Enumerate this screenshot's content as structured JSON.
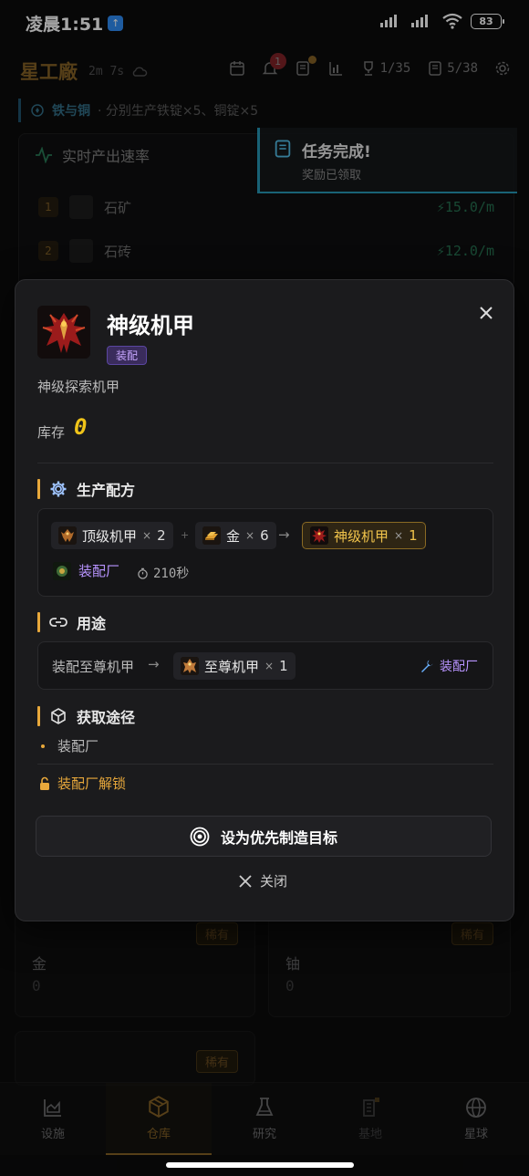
{
  "statusbar": {
    "time": "凌晨1:51",
    "battery": "83"
  },
  "header": {
    "brand": "星工廠",
    "timer": "2m 7s",
    "notif_count": "1",
    "achievements": "1/35",
    "tasks": "5/38"
  },
  "ticker": {
    "name": "铁与铜",
    "desc": "· 分别生产铁锭×5、铜锭×5"
  },
  "rate_panel": {
    "title": "实时产出速率",
    "rows": [
      {
        "rank": "1",
        "name": "石矿",
        "rate": "15.0/m"
      },
      {
        "rank": "2",
        "name": "石砖",
        "rate": "12.0/m"
      }
    ]
  },
  "toast": {
    "title": "任务完成!",
    "subtitle": "奖励已领取"
  },
  "bg_cards": [
    {
      "name": "金",
      "count": "0",
      "rarity": "稀有"
    },
    {
      "name": "铀",
      "count": "0",
      "rarity": "稀有"
    },
    {
      "rarity": "稀有"
    }
  ],
  "modal": {
    "title": "神级机甲",
    "category": "装配",
    "description": "神级探索机甲",
    "stock_label": "库存",
    "stock_value": "0",
    "recipe_heading": "生产配方",
    "recipe": {
      "inputs": [
        {
          "name": "顶级机甲",
          "mult": "×",
          "qty": "2"
        },
        {
          "name": "金",
          "mult": "×",
          "qty": "6"
        }
      ],
      "output": {
        "name": "神级机甲",
        "mult": "×",
        "qty": "1"
      },
      "factory": "装配厂",
      "duration": "210秒"
    },
    "usage_heading": "用途",
    "usage": {
      "text": "装配至尊机甲",
      "target": {
        "name": "至尊机甲",
        "mult": "×",
        "qty": "1"
      },
      "factory": "装配厂"
    },
    "source_heading": "获取途径",
    "sources": [
      "装配厂"
    ],
    "unlock": "装配厂解锁",
    "primary_button": "设为优先制造目标",
    "close_button": "关闭"
  },
  "bottom_nav": [
    {
      "label": "设施"
    },
    {
      "label": "仓库",
      "active": true
    },
    {
      "label": "研究"
    },
    {
      "label": "基地"
    },
    {
      "label": "星球"
    }
  ],
  "colors": {
    "accent": "#e8a83b",
    "purple": "#b894ff",
    "green": "#3ecf8e",
    "cyan": "#2aa6c8"
  }
}
